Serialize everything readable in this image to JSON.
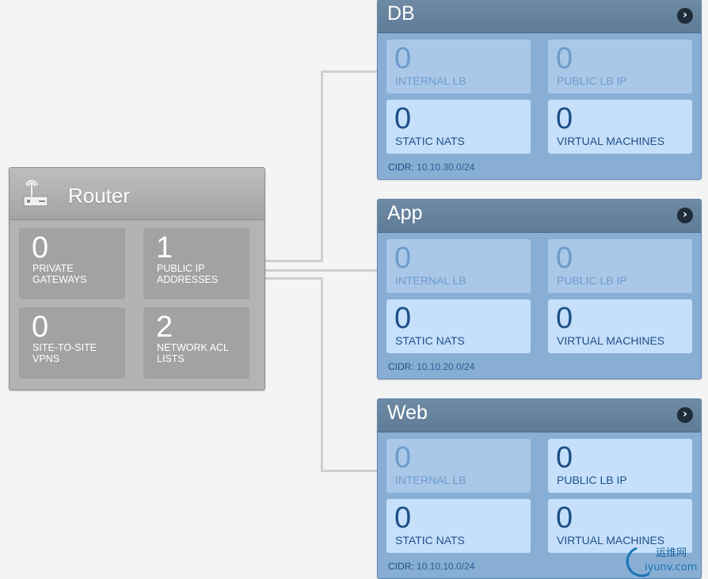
{
  "router": {
    "title": "Router",
    "tiles": [
      {
        "count": "0",
        "label": "PRIVATE GATEWAYS"
      },
      {
        "count": "1",
        "label": "PUBLIC IP ADDRESSES"
      },
      {
        "count": "0",
        "label": "SITE-TO-SITE VPNS"
      },
      {
        "count": "2",
        "label": "NETWORK ACL LISTS"
      }
    ]
  },
  "tiers": [
    {
      "name": "DB",
      "tiles": [
        {
          "count": "0",
          "label": "INTERNAL LB"
        },
        {
          "count": "0",
          "label": "PUBLIC LB IP"
        },
        {
          "count": "0",
          "label": "STATIC NATS"
        },
        {
          "count": "0",
          "label": "VIRTUAL MACHINES"
        }
      ],
      "cidr_label": "CIDR:",
      "cidr": "10.10.30.0/24"
    },
    {
      "name": "App",
      "tiles": [
        {
          "count": "0",
          "label": "INTERNAL LB"
        },
        {
          "count": "0",
          "label": "PUBLIC LB IP"
        },
        {
          "count": "0",
          "label": "STATIC NATS"
        },
        {
          "count": "0",
          "label": "VIRTUAL MACHINES"
        }
      ],
      "cidr_label": "CIDR:",
      "cidr": "10.10.20.0/24"
    },
    {
      "name": "Web",
      "tiles": [
        {
          "count": "0",
          "label": "INTERNAL LB"
        },
        {
          "count": "0",
          "label": "PUBLIC LB IP"
        },
        {
          "count": "0",
          "label": "STATIC NATS"
        },
        {
          "count": "0",
          "label": "VIRTUAL MACHINES"
        }
      ],
      "cidr_label": "CIDR:",
      "cidr": "10.10.10.0/24"
    }
  ],
  "watermark": {
    "text": "运维网",
    "url": "iyunv.com"
  },
  "colors": {
    "router_bg": "#b3b3b3",
    "tier_bg": "#88aed4",
    "tier_header": "#6e8aa5",
    "tile_dim": "#a9c8e8",
    "tile_bright": "#c6e0fb",
    "count_blue": "#1e4f86"
  },
  "icons": {
    "router": "router-icon",
    "tier_arrow": "chevron-right-icon"
  }
}
